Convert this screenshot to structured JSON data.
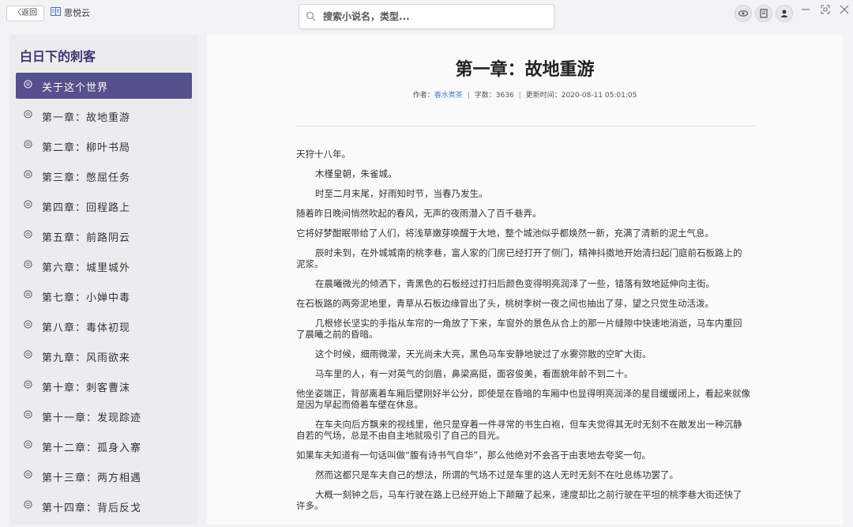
{
  "topbar": {
    "back_label": "〈返回",
    "app_name": "思悦云",
    "search_placeholder": "搜索小说名，类型..."
  },
  "icons": {
    "view": "eye-icon",
    "bookshelf": "book-icon",
    "user": "user-icon",
    "minimize": "minimize-icon",
    "maximize": "maximize-icon",
    "close": "close-icon"
  },
  "sidebar": {
    "book_title": "白日下的刺客",
    "chapters": [
      {
        "label": "关于这个世界",
        "active": true
      },
      {
        "label": "第一章：故地重游"
      },
      {
        "label": "第二章：柳叶书局"
      },
      {
        "label": "第三章：憋屈任务"
      },
      {
        "label": "第四章：回程路上"
      },
      {
        "label": "第五章：前路阴云"
      },
      {
        "label": "第六章：城里城外"
      },
      {
        "label": "第七章：小婵中毒"
      },
      {
        "label": "第八章：毒体初现"
      },
      {
        "label": "第九章：风雨欲来"
      },
      {
        "label": "第十章：刺客曹沫"
      },
      {
        "label": "第十一章：发现踪迹"
      },
      {
        "label": "第十二章：孤身入寨"
      },
      {
        "label": "第十三章：两方相遇"
      },
      {
        "label": "第十四章：背后反戈"
      }
    ]
  },
  "content": {
    "title": "第一章：故地重游",
    "meta": {
      "author_label": "作者：",
      "author": "春水煮茶",
      "words_label": "字数：",
      "words": "3636",
      "updated_label": "更新时间：",
      "updated": "2020-08-11 05:01:05"
    },
    "paragraphs": [
      {
        "text": "天狩十八年。",
        "indent": false
      },
      {
        "text": "木槿皇朝，朱雀城。",
        "indent": true
      },
      {
        "text": "时至二月末尾，好雨知时节，当春乃发生。",
        "indent": true
      },
      {
        "text": "随着昨日晚间悄然吹起的春风，无声的夜雨潜入了百千巷弄。",
        "indent": false
      },
      {
        "text": "它将好梦酣眠带给了人们，将浅草嫩芽唤醒于大地，整个城池似乎都焕然一新，充满了清新的泥土气息。",
        "indent": false
      },
      {
        "text": "辰时未到，在外城城南的桃李巷，富人家的门房已经打开了侧门，精神抖擞地开始清扫起门庭前石板路上的泥浆。",
        "indent": true
      },
      {
        "text": "在晨曦微光的倾洒下，青黑色的石板经过打扫后颜色变得明亮润泽了一些，错落有致地延伸向主街。",
        "indent": true
      },
      {
        "text": "在石板路的两旁泥地里，青草从石板边缘冒出了头，桃树李树一夜之间也抽出了芽，望之只觉生动活泼。",
        "indent": false
      },
      {
        "text": "几根修长坚实的手指从车帘的一角放了下来，车窗外的景色从合上的那一片缝隙中快速地消逝，马车内重回了晨曦之前的昏暗。",
        "indent": true
      },
      {
        "text": "这个时候，细雨微濛，天光尚未大亮，黑色马车安静地驶过了水雾弥散的空旷大街。",
        "indent": true
      },
      {
        "text": "马车里的人，有一对英气的剑眉，鼻梁高挺，面容俊美，看面貌年龄不到二十。",
        "indent": true
      },
      {
        "text": "他坐姿端正，背部离着车厢后壁刚好半公分，即使是在昏暗的车厢中也显得明亮润泽的星目缓缓闭上，看起来就像是因为早起而倚着车壁在休息。",
        "indent": false
      },
      {
        "text": "在车夫向后方飘来的视线里，他只是穿着一件寻常的书生白袍，但车夫觉得其无时无刻不在散发出一种沉静自若的气场，总是不由自主地就吸引了自己的目光。",
        "indent": true
      },
      {
        "text": "如果车夫知道有一句话叫做“腹有诗书气自华”，那么他绝对不会吝于由衷地去夸奖一句。",
        "indent": false
      },
      {
        "text": "然而这都只是车夫自己的想法，所谓的气场不过是车里的这人无时无刻不在吐息练功罢了。",
        "indent": true
      },
      {
        "text": "大概一刻钟之后，马车行驶在路上已经开始上下颠簸了起来，速度却比之前行驶在平坦的桃李巷大街还快了许多。",
        "indent": true
      }
    ]
  },
  "colors": {
    "accent": "#56508c",
    "title": "#3e3470",
    "link": "#4a7fd6"
  }
}
